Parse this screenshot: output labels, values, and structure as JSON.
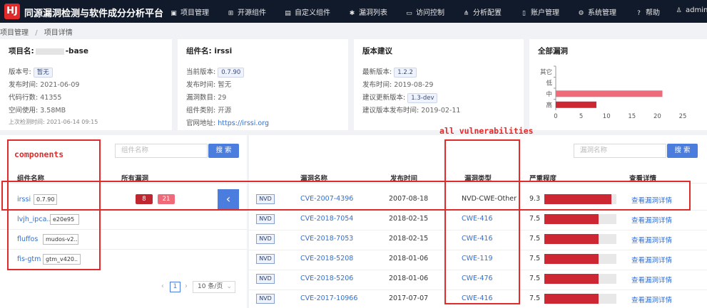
{
  "header": {
    "logo_text": "HJ",
    "title": "同源漏洞检测与软件成分分析平台",
    "nav": [
      {
        "label": "项目管理",
        "icon": "▣"
      },
      {
        "label": "开源组件",
        "icon": "⊞"
      },
      {
        "label": "自定义组件",
        "icon": "▤"
      },
      {
        "label": "漏洞列表",
        "icon": "✱"
      },
      {
        "label": "访问控制",
        "icon": "▭"
      },
      {
        "label": "分析配置",
        "icon": "⋔"
      },
      {
        "label": "账户管理",
        "icon": "▯"
      },
      {
        "label": "系统管理",
        "icon": "⚙"
      },
      {
        "label": "帮助",
        "icon": "?"
      },
      {
        "label": "admin",
        "icon": "♙"
      }
    ]
  },
  "breadcrumb": {
    "parent": "项目管理",
    "sep": "/",
    "current": "项目详情"
  },
  "project_card": {
    "title_prefix": "项目名:",
    "title_suffix": "-base",
    "version_label": "版本号:",
    "version": "暂无",
    "release_label": "发布时间:",
    "release": "2021-06-09",
    "loc_label": "代码行数:",
    "loc": "41355",
    "space_label": "空间使用:",
    "space": "3.58MB",
    "lastscan_label": "上次检测时间:",
    "lastscan": "2021-06-14 09:15"
  },
  "component_card": {
    "title": "组件名: irssi",
    "current_label": "当前版本:",
    "current": "0.7.90",
    "release_label": "发布时间:",
    "release": "暂无",
    "vulns_label": "漏洞数目:",
    "vulns": "29",
    "category_label": "组件类别:",
    "category": "开源",
    "site_label": "官网地址:",
    "site": "https://irssi.org"
  },
  "advice_card": {
    "title": "版本建议",
    "latest_label": "最新版本:",
    "latest": "1.2.2",
    "latest_date_label": "发布时间:",
    "latest_date": "2019-08-29",
    "suggest_label": "建议更新版本:",
    "suggest": "1.3-dev",
    "suggest_date_label": "建议版本发布时间:",
    "suggest_date": "2019-02-11"
  },
  "chart_data": {
    "type": "bar",
    "orientation": "horizontal",
    "title": "全部漏洞",
    "categories": [
      "其它",
      "低",
      "中",
      "高"
    ],
    "values": [
      0,
      0,
      21,
      8
    ],
    "colors": [
      "#999999",
      "#999999",
      "#f06b7a",
      "#cc2733"
    ],
    "xlim": [
      0,
      25
    ],
    "xticks": [
      "0",
      "5",
      "10",
      "15",
      "20",
      "25"
    ],
    "grid": false,
    "legend": "none"
  },
  "components_panel": {
    "search_placeholder": "组件名称",
    "search_button": "搜 索",
    "col_name": "组件名称",
    "col_vulns": "所有漏洞",
    "rows": [
      {
        "name": "irssi",
        "version": "0.7.90",
        "high": "8",
        "mid": "21"
      },
      {
        "name": "lvjh_ipca..",
        "version": "e20e95"
      },
      {
        "name": "fluffos",
        "version": "mudos-v2.."
      },
      {
        "name": "fis-gtm",
        "version": "gtm_v420.."
      }
    ],
    "collapse_glyph": "‹",
    "pagination": {
      "prev": "‹",
      "page": "1",
      "next": "›",
      "page_size": "10 条/页"
    }
  },
  "vulns_panel": {
    "search_placeholder": "漏洞名称",
    "search_button": "搜 索",
    "cols": {
      "name": "漏洞名称",
      "date": "发布时间",
      "type": "漏洞类型",
      "severity": "严重程度",
      "detail": "查看详情"
    },
    "rows": [
      {
        "source": "NVD",
        "id": "CVE-2007-4396",
        "date": "2007-08-18",
        "type": "NVD-CWE-Other",
        "score": "9.3",
        "detail": "查看漏洞详情"
      },
      {
        "source": "NVD",
        "id": "CVE-2018-7054",
        "date": "2018-02-15",
        "type": "CWE-416",
        "score": "7.5",
        "detail": "查看漏洞详情"
      },
      {
        "source": "NVD",
        "id": "CVE-2018-7053",
        "date": "2018-02-15",
        "type": "CWE-416",
        "score": "7.5",
        "detail": "查看漏洞详情"
      },
      {
        "source": "NVD",
        "id": "CVE-2018-5208",
        "date": "2018-01-06",
        "type": "CWE-119",
        "score": "7.5",
        "detail": "查看漏洞详情"
      },
      {
        "source": "NVD",
        "id": "CVE-2018-5206",
        "date": "2018-01-06",
        "type": "CWE-476",
        "score": "7.5",
        "detail": "查看漏洞详情"
      },
      {
        "source": "NVD",
        "id": "CVE-2017-10966",
        "date": "2017-07-07",
        "type": "CWE-416",
        "score": "7.5",
        "detail": "查看漏洞详情"
      }
    ],
    "score_max": 10
  },
  "annotations": {
    "components": "components",
    "all_vulns": "all vulnerabilities"
  }
}
